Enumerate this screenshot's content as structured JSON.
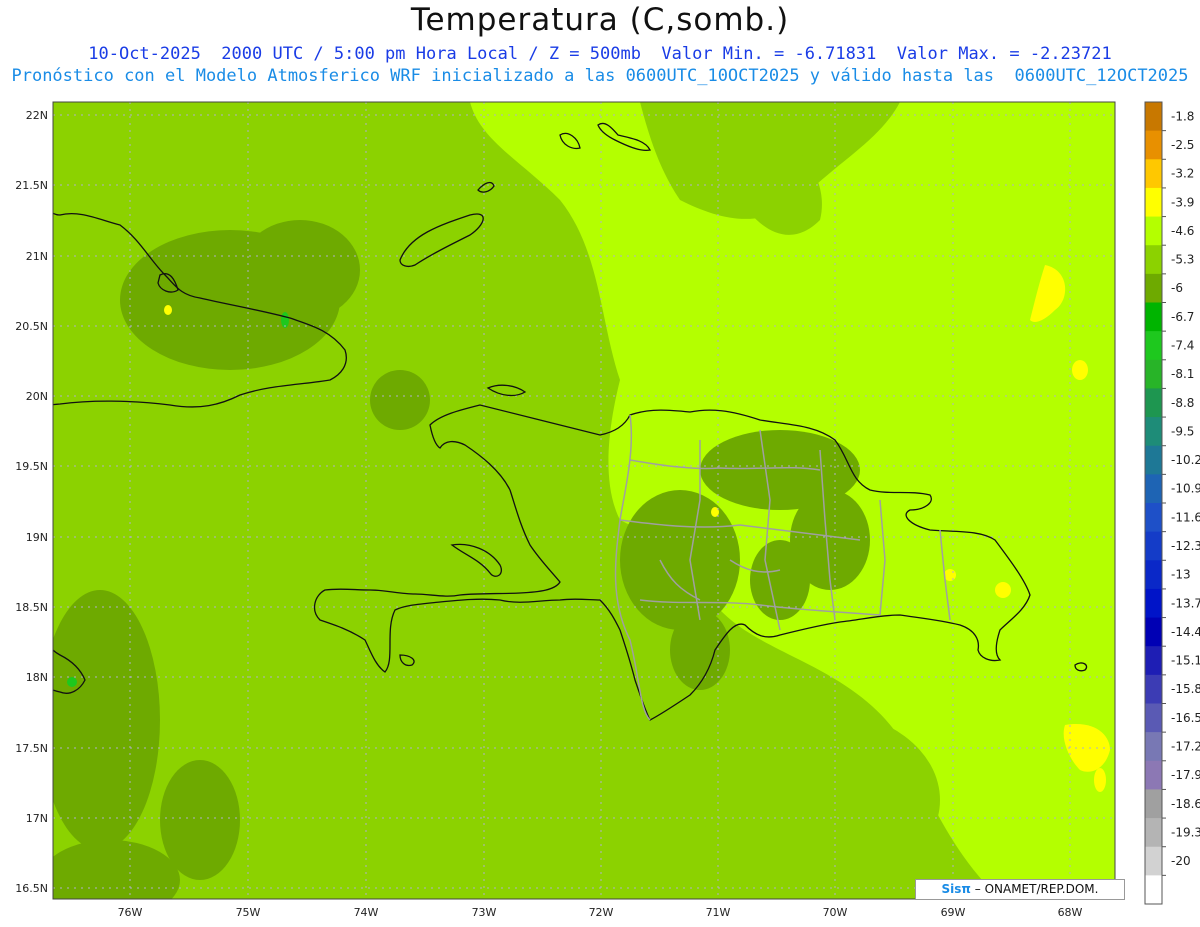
{
  "title": "Temperatura (C,somb.)",
  "subtitle_line1": "10-Oct-2025  2000 UTC / 5:00 pm Hora Local / Z = 500mb  Valor Min. = -6.71831  Valor Max. = -2.23721",
  "subtitle_line2": "Pronóstico con el Modelo Atmosferico WRF inicializado a las 0600UTC_10OCT2025 y válido hasta las  0600UTC_12OCT2025",
  "lat_labels": [
    "22N",
    "21.5N",
    "21N",
    "20.5N",
    "20N",
    "19.5N",
    "19N",
    "18.5N",
    "18N",
    "17.5N",
    "17N",
    "16.5N"
  ],
  "lon_labels": [
    "76W",
    "75W",
    "74W",
    "73W",
    "72W",
    "71W",
    "70W",
    "69W",
    "68W"
  ],
  "colorbar": {
    "labels": [
      "-1.8",
      "-2.5",
      "-3.2",
      "-3.9",
      "-4.6",
      "-5.3",
      "-6",
      "-6.7",
      "-7.4",
      "-8.1",
      "-8.8",
      "-9.5",
      "-10.2",
      "-10.9",
      "-11.6",
      "-12.3",
      "-13",
      "-13.7",
      "-14.4",
      "-15.1",
      "-15.8",
      "-16.5",
      "-17.2",
      "-17.9",
      "-18.6",
      "-19.3",
      "-20"
    ],
    "colors": [
      "#c87800",
      "#e89000",
      "#ffc800",
      "#ffff00",
      "#b4ff00",
      "#8cd200",
      "#6eaa00",
      "#00b400",
      "#1ec81e",
      "#28b428",
      "#1e9650",
      "#1e8c78",
      "#1e7896",
      "#1e64b4",
      "#1e50c8",
      "#143cc8",
      "#0a28c8",
      "#0014c8",
      "#0000b4",
      "#1e1eb4",
      "#3c3cb4",
      "#5a5ab4",
      "#7878b4",
      "#8c78b4",
      "#a0a0a0",
      "#b4b4b4",
      "#d2d2d2",
      "#ffffff"
    ]
  },
  "colors": {
    "field_base": "#8cd200",
    "field_warm": "#b4ff00",
    "field_cool": "#6eaa00",
    "field_hot": "#ffff00",
    "coast": "#111111",
    "borders": "#a0a0a0"
  },
  "credit": {
    "logo": "Sisπ",
    "text": "– ONAMET/REP.DOM."
  }
}
